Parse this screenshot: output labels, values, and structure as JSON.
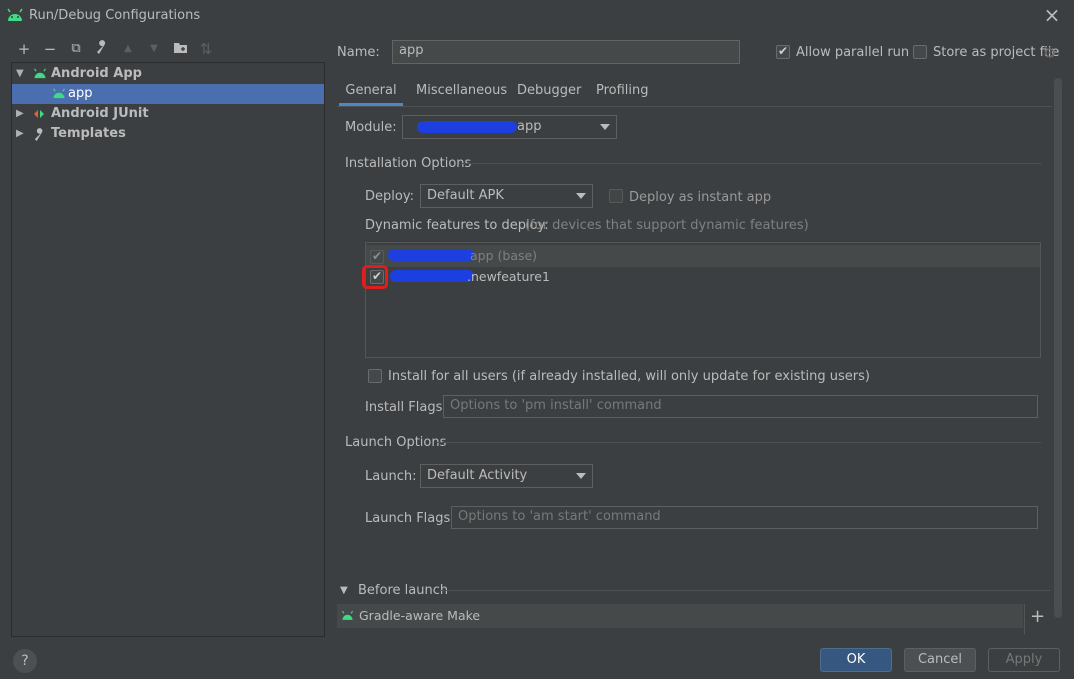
{
  "window": {
    "title": "Run/Debug Configurations"
  },
  "toolbar": {
    "add": "+",
    "remove": "−",
    "copy": "⧉",
    "edit": "🔧",
    "up": "▲",
    "down": "▼",
    "folder": "📁",
    "sort": "⇅"
  },
  "tree": {
    "items": [
      {
        "label": "Android App",
        "expanded": true
      },
      {
        "label": "app",
        "selected": true
      },
      {
        "label": "Android JUnit"
      },
      {
        "label": "Templates"
      }
    ]
  },
  "form": {
    "name_label": "Name:",
    "name_value": "app",
    "allow_parallel_label": "Allow parallel run",
    "store_label": "Store as project file"
  },
  "tabs": [
    "General",
    "Miscellaneous",
    "Debugger",
    "Profiling"
  ],
  "general": {
    "module_label": "Module:",
    "module_value": "app",
    "installation_header": "Installation Options",
    "deploy_label": "Deploy:",
    "deploy_value": "Default APK",
    "instant_label": "Deploy as instant app",
    "dynamic_label": "Dynamic features to deploy:",
    "dynamic_hint": "(for devices that support dynamic features)",
    "features": [
      {
        "label": "app (base)",
        "checked": true,
        "disabled": true
      },
      {
        "label": ".newfeature1",
        "checked": true
      }
    ],
    "install_all_label": "Install for all users (if already installed, will only update for existing users)",
    "install_flags_label": "Install Flags:",
    "install_flags_placeholder": "Options to 'pm install' command",
    "launch_header": "Launch Options",
    "launch_label": "Launch:",
    "launch_value": "Default Activity",
    "launch_flags_label": "Launch Flags:",
    "launch_flags_placeholder": "Options to 'am start' command"
  },
  "before_launch": {
    "header": "Before launch",
    "task": "Gradle-aware Make",
    "add": "+"
  },
  "buttons": {
    "ok": "OK",
    "cancel": "Cancel",
    "apply": "Apply",
    "help": "?"
  },
  "colors": {
    "selection": "#4b6eaf",
    "accent": "#4a88c7",
    "android_green": "#3ddc84",
    "highlight": "#e01e1e"
  }
}
